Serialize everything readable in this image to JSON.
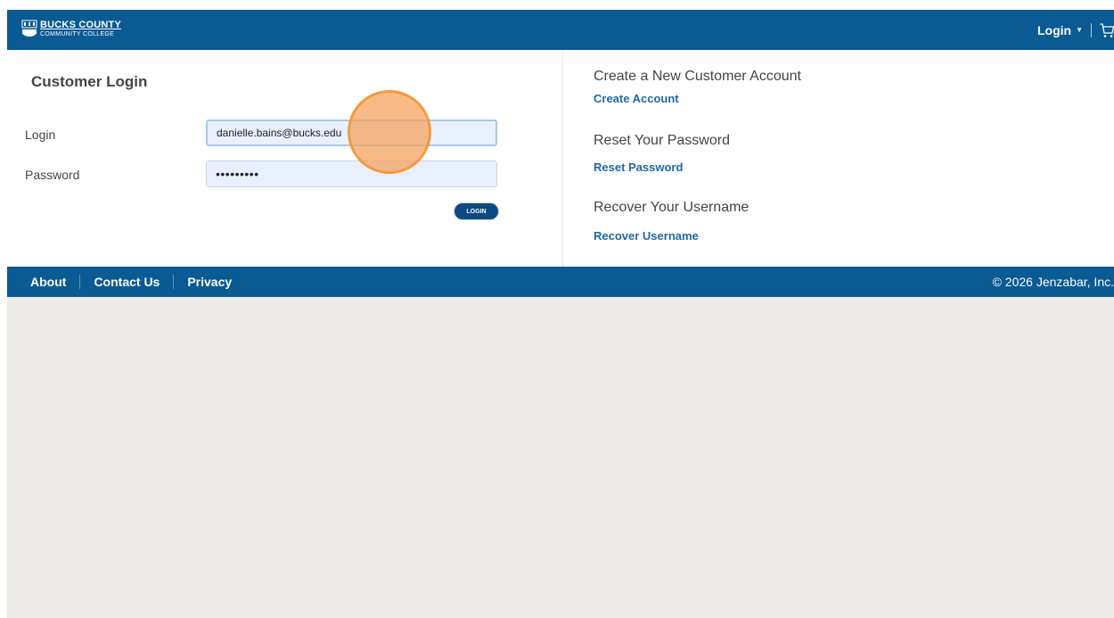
{
  "header": {
    "logo_line1": "BUCKS COUNTY",
    "logo_line2": "COMMUNITY COLLEGE",
    "login_label": "Login",
    "caret_icon": "caret-down-icon",
    "cart_icon": "shopping-cart-icon",
    "background_color": "#0a5a94"
  },
  "login_form": {
    "title": "Customer Login",
    "login_label": "Login",
    "login_value": "danielle.bains@bucks.edu",
    "password_label": "Password",
    "password_value": "•••••••••",
    "submit_label": "LOGIN"
  },
  "sidebar": {
    "create_heading": "Create a New Customer Account",
    "create_link": "Create Account",
    "reset_heading": "Reset Your Password",
    "reset_link": "Reset Password",
    "recover_heading": "Recover Your Username",
    "recover_link": "Recover Username",
    "link_color": "#1d6aa5"
  },
  "footer": {
    "links": [
      "About",
      "Contact Us",
      "Privacy"
    ],
    "copyright": "© 2026 Jenzabar, Inc."
  }
}
